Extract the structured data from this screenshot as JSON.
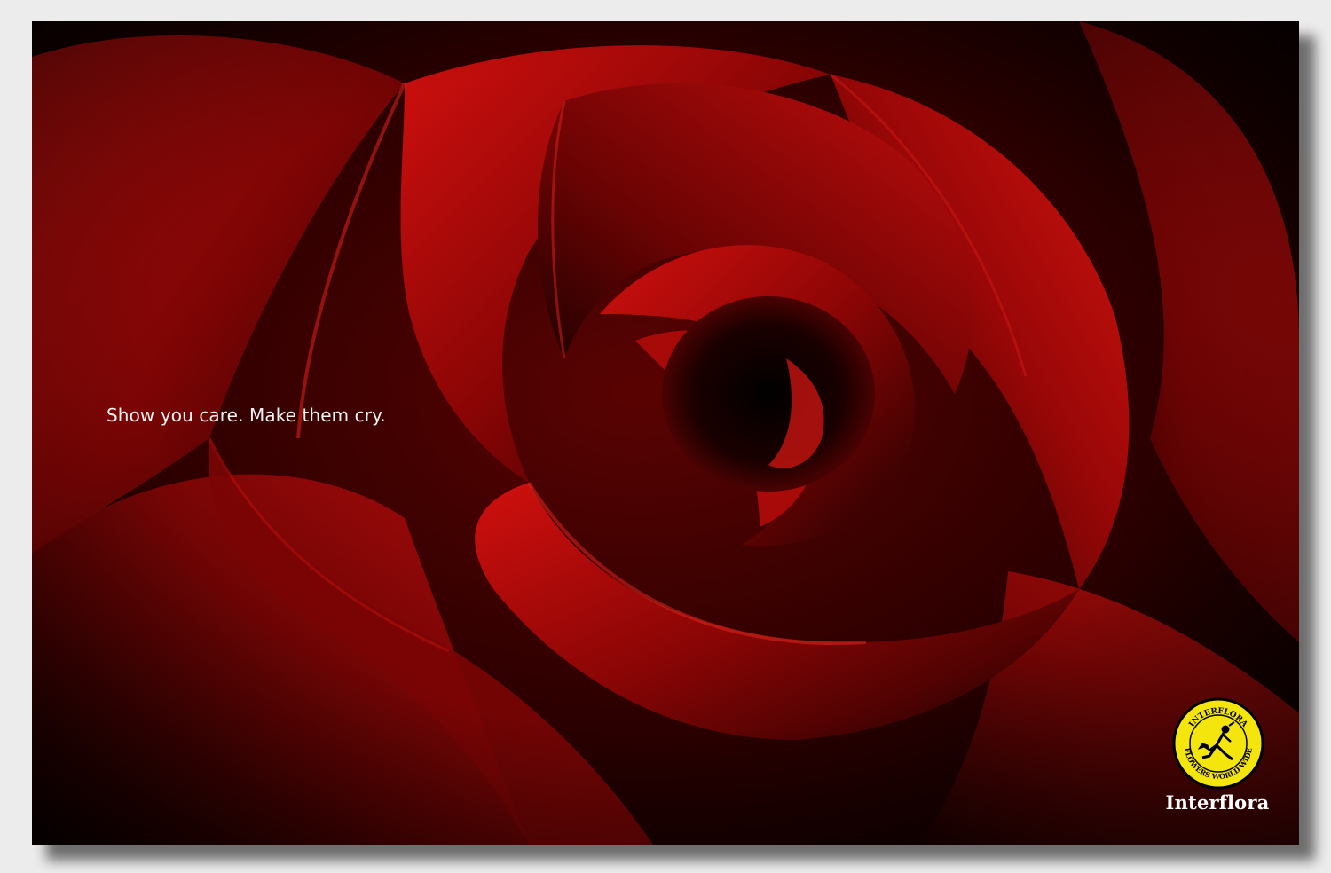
{
  "ad": {
    "tagline": "Show you care. Make them cry.",
    "colors": {
      "page_background": "#ececec",
      "poster_background": "#000000",
      "petal_red": "#c40d0d",
      "petal_dark": "#3a0000",
      "logo_yellow": "#f4e60c",
      "text": "#ffffff"
    }
  },
  "brand": {
    "name": "Interflora",
    "badge_text_top": "INTERFLORA",
    "badge_text_bottom": "FLOWERS WORLD WIDE",
    "badge_icon": "mercury-runner-icon"
  }
}
